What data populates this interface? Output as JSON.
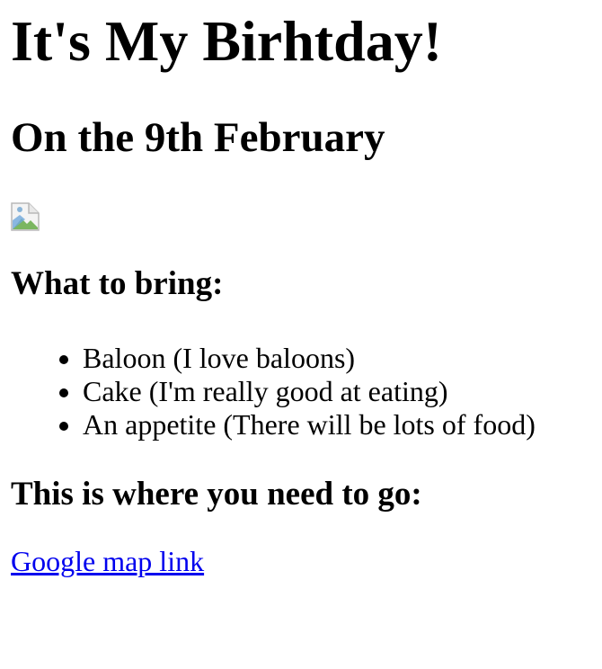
{
  "page": {
    "title": "It's My Birhtday!",
    "subtitle": "On the 9th February",
    "image_icon": "broken-image-icon",
    "bring_heading": "What to bring:",
    "bring_items": [
      "Baloon (I love baloons)",
      "Cake (I'm really good at eating)",
      "An appetite (There will be lots of food)"
    ],
    "where_heading": "This is where you need to go:",
    "map_link_label": "Google map link"
  },
  "colors": {
    "link": "#0000ee",
    "text": "#000000",
    "background": "#ffffff"
  }
}
